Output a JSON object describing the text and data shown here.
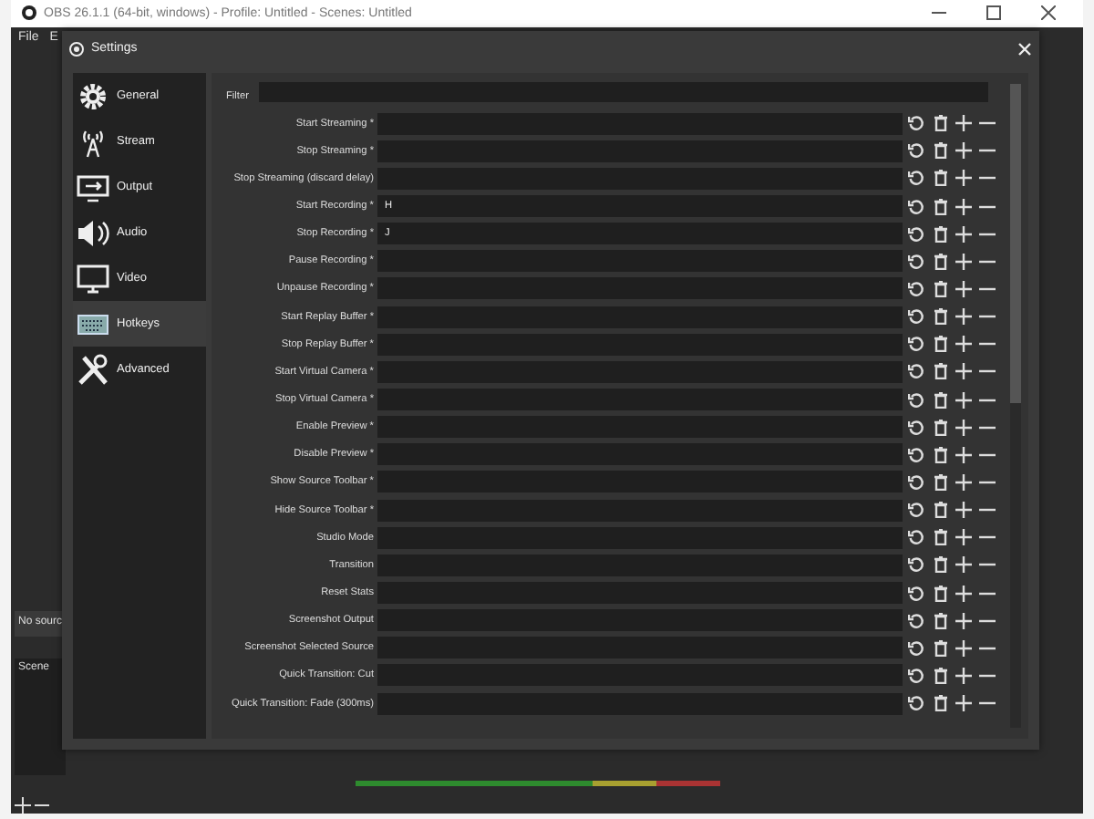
{
  "window": {
    "title": "OBS 26.1.1 (64-bit, windows) - Profile: Untitled - Scenes: Untitled"
  },
  "menu": [
    "File",
    "E"
  ],
  "sources": {
    "empty_text": "No sourc"
  },
  "scenes": {
    "title": "Scene"
  },
  "dialog": {
    "title": "Settings",
    "sidebar": [
      {
        "label": "General",
        "selected": false
      },
      {
        "label": "Stream",
        "selected": false
      },
      {
        "label": "Output",
        "selected": false
      },
      {
        "label": "Audio",
        "selected": false
      },
      {
        "label": "Video",
        "selected": false
      },
      {
        "label": "Hotkeys",
        "selected": true
      },
      {
        "label": "Advanced",
        "selected": false
      }
    ],
    "filter": {
      "label": "Filter"
    },
    "hotkeys": [
      {
        "label": "Start Streaming *"
      },
      {
        "label": "Stop Streaming *"
      },
      {
        "label": "Stop Streaming (discard delay)"
      },
      {
        "label": "Start Recording *",
        "value": "H"
      },
      {
        "label": "Stop Recording *",
        "value": "J"
      },
      {
        "label": "Pause Recording *"
      },
      {
        "label": "Unpause Recording *"
      },
      {
        "label": "Start Replay Buffer *"
      },
      {
        "label": "Stop Replay Buffer *"
      },
      {
        "label": "Start Virtual Camera *"
      },
      {
        "label": "Stop Virtual Camera *"
      },
      {
        "label": "Enable Preview *"
      },
      {
        "label": "Disable Preview *"
      },
      {
        "label": "Show Source Toolbar *"
      },
      {
        "label": "Hide Source Toolbar *"
      },
      {
        "label": "Studio Mode"
      },
      {
        "label": "Transition"
      },
      {
        "label": "Reset Stats"
      },
      {
        "label": "Screenshot Output"
      },
      {
        "label": "Screenshot Selected Source"
      },
      {
        "label": "Quick Transition: Cut"
      },
      {
        "label": "Quick Transition: Fade (300ms)"
      }
    ]
  }
}
